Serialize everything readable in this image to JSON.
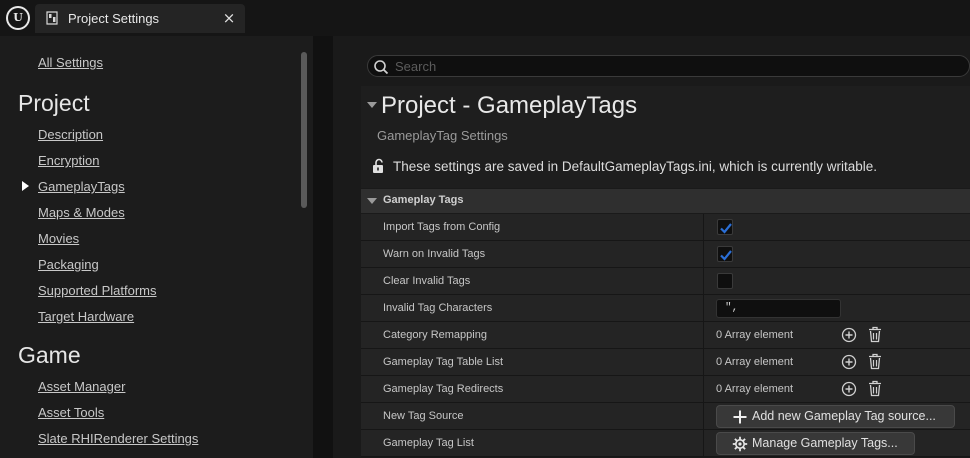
{
  "window": {
    "tab_title": "Project Settings",
    "close_glyph": "×"
  },
  "nav": {
    "all_settings": "All Settings",
    "sections": [
      {
        "title": "Project",
        "items": [
          "Description",
          "Encryption",
          "GameplayTags",
          "Maps & Modes",
          "Movies",
          "Packaging",
          "Supported Platforms",
          "Target Hardware"
        ]
      },
      {
        "title": "Game",
        "items": [
          "Asset Manager",
          "Asset Tools",
          "Slate RHIRenderer Settings"
        ]
      }
    ],
    "active_item": "GameplayTags"
  },
  "search": {
    "placeholder": "Search"
  },
  "header": {
    "title": "Project - GameplayTags",
    "subtitle": "GameplayTag Settings",
    "writable_notice": "These settings are saved in DefaultGameplayTags.ini, which is currently writable."
  },
  "category": {
    "label": "Gameplay Tags"
  },
  "properties": [
    {
      "name": "Import Tags from Config",
      "type": "checkbox",
      "checked": true
    },
    {
      "name": "Warn on Invalid Tags",
      "type": "checkbox",
      "checked": true
    },
    {
      "name": "Clear Invalid Tags",
      "type": "checkbox",
      "checked": false
    },
    {
      "name": "Invalid Tag Characters",
      "type": "text",
      "value": "\",",
      "shown_value": "\","
    },
    {
      "name": "Category Remapping",
      "type": "array",
      "value": "0 Array element"
    },
    {
      "name": "Gameplay Tag Table List",
      "type": "array",
      "value": "0 Array element"
    },
    {
      "name": "Gameplay Tag Redirects",
      "type": "array",
      "value": "0 Array element"
    },
    {
      "name": "New Tag Source",
      "type": "button",
      "value": "Add new Gameplay Tag source...",
      "icon": "plus-icon"
    },
    {
      "name": "Gameplay Tag List",
      "type": "button",
      "value": "Manage Gameplay Tags...",
      "icon": "gear-icon"
    }
  ],
  "colors": {
    "accent_check": "#2b6fd6",
    "background": "#151515",
    "panel": "#1c1c1c"
  }
}
